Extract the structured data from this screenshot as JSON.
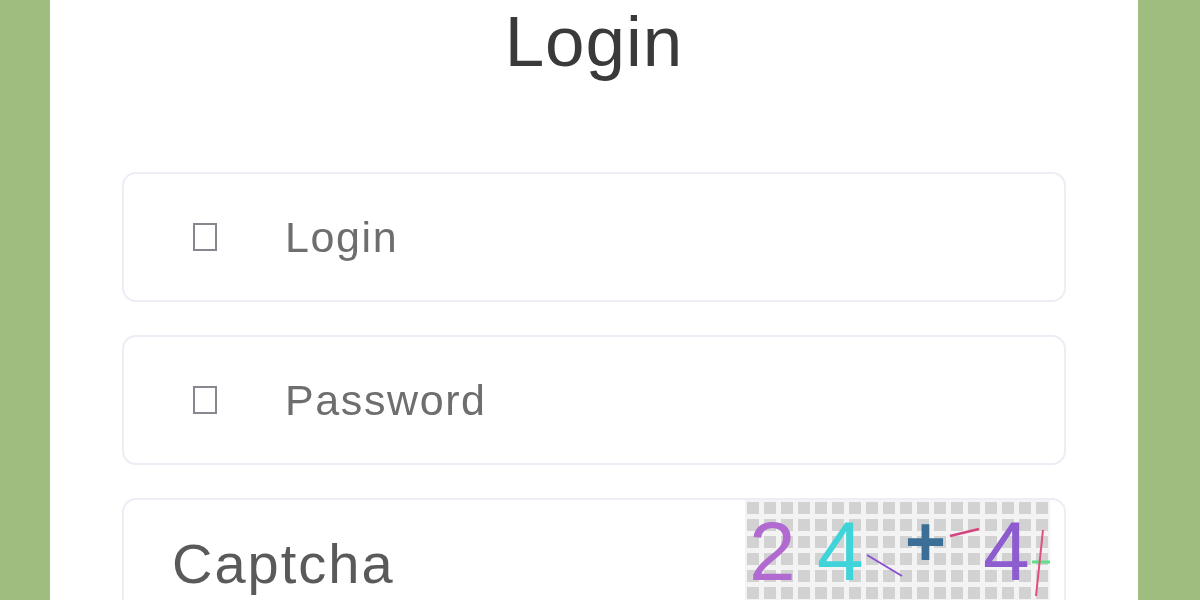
{
  "title": "Login",
  "fields": [
    {
      "kind": "username",
      "placeholder": "Login"
    },
    {
      "kind": "password",
      "placeholder": "Password"
    },
    {
      "kind": "captcha",
      "placeholder": "Captcha",
      "captcha_characters": [
        {
          "text": "2",
          "color": "#b06ad0"
        },
        {
          "text": "4",
          "color": "#3fd3da"
        },
        {
          "text": "+",
          "color": "#3b6f98"
        },
        {
          "text": "4",
          "color": "#8d5ccf"
        }
      ]
    }
  ]
}
